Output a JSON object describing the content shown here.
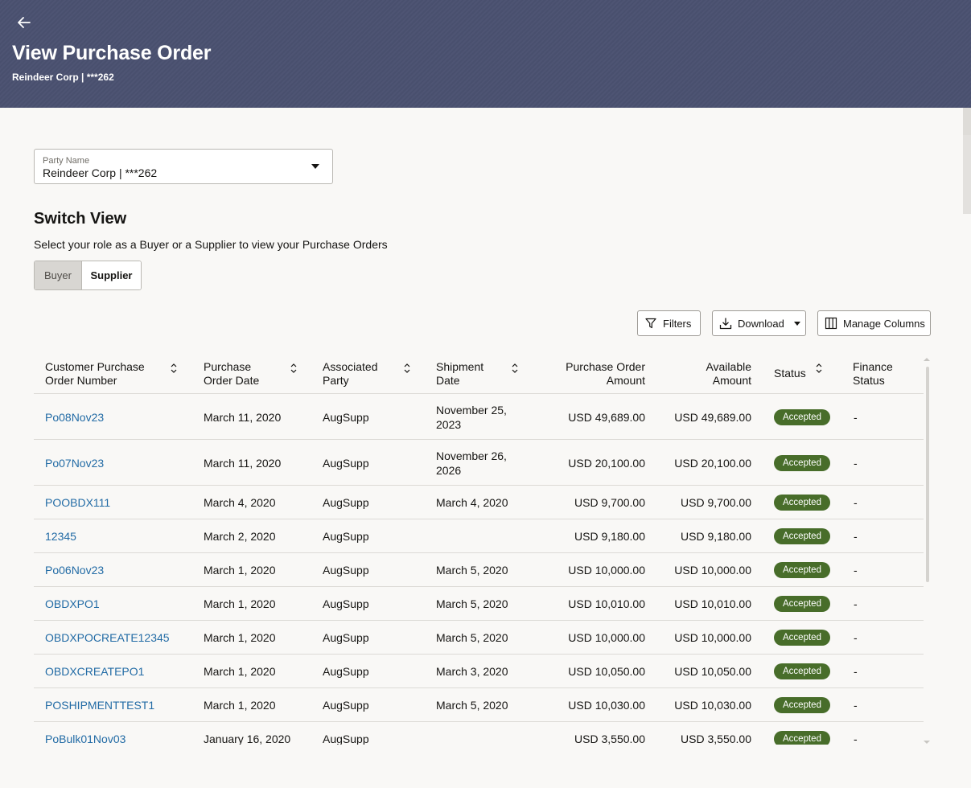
{
  "header": {
    "title": "View Purchase Order",
    "subtitle": "Reindeer Corp | ***262",
    "back_icon": "arrow-left-icon",
    "background_color": "#4a5170"
  },
  "party": {
    "label": "Party Name",
    "value": "Reindeer Corp | ***262"
  },
  "switch_view": {
    "title": "Switch View",
    "description": "Select your role as a Buyer or a Supplier to view your Purchase Orders",
    "options": [
      "Buyer",
      "Supplier"
    ],
    "selected": "Buyer"
  },
  "toolbar": {
    "filters_label": "Filters",
    "download_label": "Download",
    "manage_columns_label": "Manage Columns"
  },
  "table": {
    "headers": {
      "po_number": [
        "Customer Purchase",
        "Order Number"
      ],
      "po_date": [
        "Purchase",
        "Order Date"
      ],
      "party": [
        "Associated",
        "Party"
      ],
      "shipment": [
        "Shipment",
        "Date"
      ],
      "amount": [
        "Purchase Order",
        "Amount"
      ],
      "available": [
        "Available",
        "Amount"
      ],
      "status": [
        "Status"
      ],
      "finance": [
        "Finance",
        "Status"
      ]
    },
    "rows": [
      {
        "po_number": "Po08Nov23",
        "po_date": "March 11, 2020",
        "party": "AugSupp",
        "shipment": [
          "November 25,",
          "2023"
        ],
        "amount": "USD 49,689.00",
        "available": "USD 49,689.00",
        "status": "Accepted",
        "finance": "-"
      },
      {
        "po_number": "Po07Nov23",
        "po_date": "March 11, 2020",
        "party": "AugSupp",
        "shipment": [
          "November 26,",
          "2026"
        ],
        "amount": "USD 20,100.00",
        "available": "USD 20,100.00",
        "status": "Accepted",
        "finance": "-"
      },
      {
        "po_number": "POOBDX111",
        "po_date": "March 4, 2020",
        "party": "AugSupp",
        "shipment": [
          "March 4, 2020"
        ],
        "amount": "USD 9,700.00",
        "available": "USD 9,700.00",
        "status": "Accepted",
        "finance": "-"
      },
      {
        "po_number": "12345",
        "po_date": "March 2, 2020",
        "party": "AugSupp",
        "shipment": [
          ""
        ],
        "amount": "USD 9,180.00",
        "available": "USD 9,180.00",
        "status": "Accepted",
        "finance": "-"
      },
      {
        "po_number": "Po06Nov23",
        "po_date": "March 1, 2020",
        "party": "AugSupp",
        "shipment": [
          "March 5, 2020"
        ],
        "amount": "USD 10,000.00",
        "available": "USD 10,000.00",
        "status": "Accepted",
        "finance": "-"
      },
      {
        "po_number": "OBDXPO1",
        "po_date": "March 1, 2020",
        "party": "AugSupp",
        "shipment": [
          "March 5, 2020"
        ],
        "amount": "USD 10,010.00",
        "available": "USD 10,010.00",
        "status": "Accepted",
        "finance": "-"
      },
      {
        "po_number": "OBDXPOCREATE12345",
        "po_date": "March 1, 2020",
        "party": "AugSupp",
        "shipment": [
          "March 5, 2020"
        ],
        "amount": "USD 10,000.00",
        "available": "USD 10,000.00",
        "status": "Accepted",
        "finance": "-"
      },
      {
        "po_number": "OBDXCREATEPO1",
        "po_date": "March 1, 2020",
        "party": "AugSupp",
        "shipment": [
          "March 3, 2020"
        ],
        "amount": "USD 10,050.00",
        "available": "USD 10,050.00",
        "status": "Accepted",
        "finance": "-"
      },
      {
        "po_number": "POSHIPMENTTEST1",
        "po_date": "March 1, 2020",
        "party": "AugSupp",
        "shipment": [
          "March 5, 2020"
        ],
        "amount": "USD 10,030.00",
        "available": "USD 10,030.00",
        "status": "Accepted",
        "finance": "-"
      },
      {
        "po_number": "PoBulk01Nov03",
        "po_date": "January 16, 2020",
        "party": "AugSupp",
        "shipment": [
          ""
        ],
        "amount": "USD 3,550.00",
        "available": "USD 3,550.00",
        "status": "Accepted",
        "finance": "-"
      }
    ],
    "status_color": "#486d2a",
    "link_color": "#226ba5"
  }
}
